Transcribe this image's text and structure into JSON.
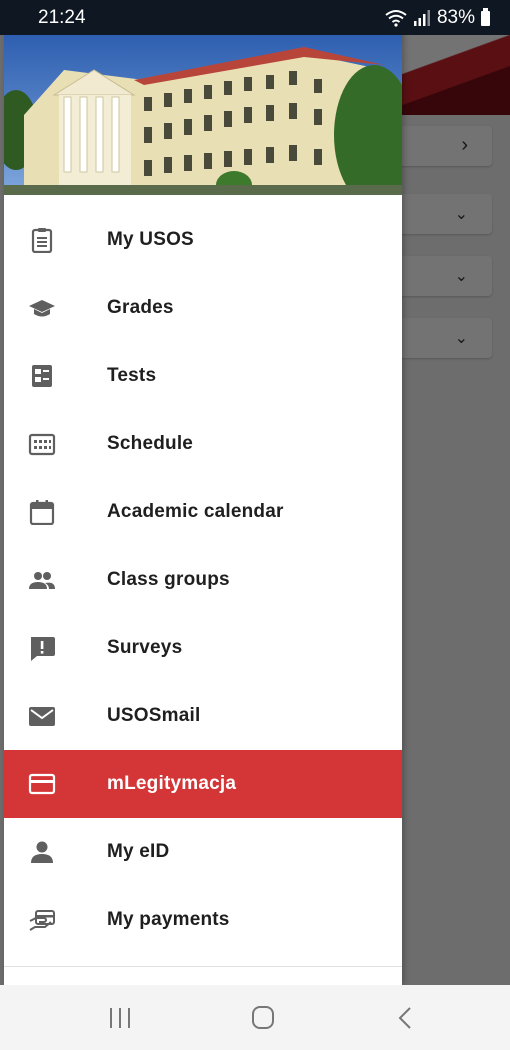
{
  "status_bar": {
    "time": "21:24",
    "battery": "83%"
  },
  "drawer": {
    "items": [
      {
        "label": "My USOS",
        "icon": "clipboard-icon"
      },
      {
        "label": "Grades",
        "icon": "graduation-cap-icon"
      },
      {
        "label": "Tests",
        "icon": "test-list-icon"
      },
      {
        "label": "Schedule",
        "icon": "schedule-grid-icon"
      },
      {
        "label": "Academic calendar",
        "icon": "calendar-icon"
      },
      {
        "label": "Class groups",
        "icon": "people-icon"
      },
      {
        "label": "Surveys",
        "icon": "feedback-icon"
      },
      {
        "label": "USOSmail",
        "icon": "mail-icon"
      },
      {
        "label": "mLegitymacja",
        "icon": "id-card-icon",
        "active": true
      },
      {
        "label": "My eID",
        "icon": "person-icon"
      },
      {
        "label": "My payments",
        "icon": "payments-icon"
      }
    ]
  },
  "colors": {
    "active": "#d43537",
    "status_bar": "#0f1722",
    "icon": "#5f5f5f"
  },
  "navbar": {
    "buttons": [
      "recent-apps",
      "home",
      "back"
    ]
  }
}
